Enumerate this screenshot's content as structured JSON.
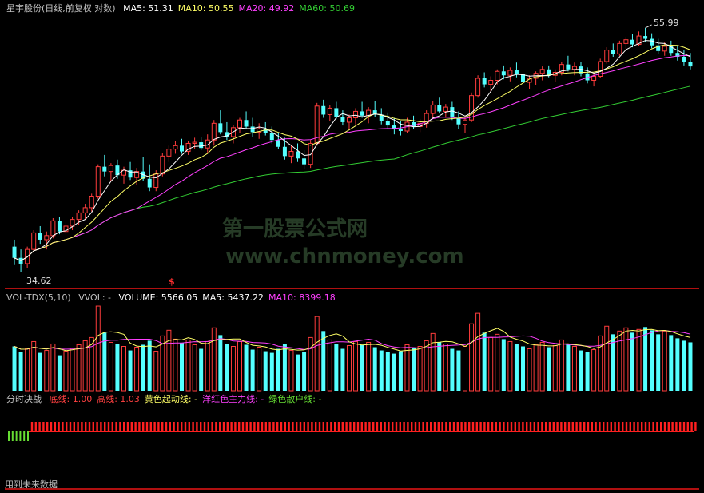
{
  "colors": {
    "bg": "#000000",
    "up": "#ff3c3c",
    "down": "#54ffff",
    "ma5": "#ffffff",
    "ma10": "#ffff66",
    "ma20": "#ff40ff",
    "ma60": "#33cc33",
    "frame": "#b01010",
    "green_bar": "#66dd33"
  },
  "price_panel": {
    "title": "星宇股份(日线,前复权 对数)",
    "ma_labels": [
      {
        "text": "MA5: 51.31",
        "color": "#ffffff"
      },
      {
        "text": "MA10: 50.55",
        "color": "#ffff66"
      },
      {
        "text": "MA20: 49.92",
        "color": "#ff40ff"
      },
      {
        "text": "MA60: 50.69",
        "color": "#33cc33"
      }
    ],
    "high_label": "55.99",
    "low_label": "34.62",
    "marker_label": "$"
  },
  "volume_panel": {
    "title": "VOL-TDX(5,10)",
    "vvol": "VVOL: -",
    "labels": [
      {
        "text": "VOLUME: 5566.05",
        "color": "#ffffff"
      },
      {
        "text": "MA5: 5437.22",
        "color": "#ffffff"
      },
      {
        "text": "MA10: 8399.18",
        "color": "#ff40ff"
      }
    ]
  },
  "indicator_panel": {
    "title": "分时决战",
    "labels": [
      {
        "text": "底线: 1.00",
        "color": "#ff4040"
      },
      {
        "text": "高线: 1.03",
        "color": "#ff4040"
      },
      {
        "text": "黄色起动线: -",
        "color": "#ffff66"
      },
      {
        "text": "洋红色主力线: -",
        "color": "#ff40ff"
      },
      {
        "text": "绿色散户线: -",
        "color": "#66dd33"
      }
    ],
    "footer": "用到未来数据"
  },
  "watermark": {
    "line1": "第一股票公式网",
    "line2": "www.chnmoney.com"
  },
  "chart_data": {
    "type": "candlestick",
    "scale": "log",
    "ylim": [
      34.62,
      55.99
    ],
    "candles": [
      [
        36.4,
        36.9,
        35.1,
        35.6
      ],
      [
        35.6,
        36.2,
        34.62,
        35.2
      ],
      [
        35.2,
        36.4,
        34.9,
        36.2
      ],
      [
        36.2,
        37.6,
        36.0,
        37.4
      ],
      [
        37.4,
        37.9,
        36.6,
        36.9
      ],
      [
        36.9,
        37.5,
        36.2,
        37.2
      ],
      [
        37.2,
        38.5,
        37.0,
        38.3
      ],
      [
        38.3,
        38.6,
        37.3,
        37.5
      ],
      [
        37.5,
        38.2,
        37.2,
        37.9
      ],
      [
        37.9,
        38.6,
        37.6,
        38.4
      ],
      [
        38.4,
        39.1,
        38.0,
        38.9
      ],
      [
        38.9,
        39.6,
        38.4,
        39.3
      ],
      [
        39.3,
        40.4,
        39.0,
        40.2
      ],
      [
        40.2,
        42.8,
        40.0,
        42.6
      ],
      [
        42.6,
        43.6,
        41.8,
        42.2
      ],
      [
        42.2,
        42.9,
        41.4,
        42.7
      ],
      [
        42.7,
        43.2,
        41.6,
        41.9
      ],
      [
        41.9,
        42.6,
        41.2,
        42.3
      ],
      [
        42.3,
        43.0,
        41.5,
        41.7
      ],
      [
        41.7,
        42.5,
        41.1,
        42.2
      ],
      [
        42.2,
        43.4,
        41.4,
        41.6
      ],
      [
        41.6,
        42.8,
        40.6,
        40.9
      ],
      [
        40.9,
        42.3,
        40.6,
        42.0
      ],
      [
        42.0,
        43.8,
        41.8,
        43.5
      ],
      [
        43.5,
        44.4,
        43.0,
        44.1
      ],
      [
        44.1,
        44.8,
        43.7,
        44.4
      ],
      [
        44.4,
        45.0,
        43.7,
        43.9
      ],
      [
        43.9,
        44.8,
        43.6,
        44.6
      ],
      [
        44.6,
        45.1,
        44.1,
        44.7
      ],
      [
        44.7,
        45.2,
        44.0,
        44.2
      ],
      [
        44.2,
        45.4,
        43.8,
        44.9
      ],
      [
        44.9,
        46.7,
        44.4,
        46.4
      ],
      [
        46.4,
        47.6,
        45.4,
        45.6
      ],
      [
        45.6,
        46.5,
        44.9,
        45.2
      ],
      [
        45.2,
        46.2,
        44.6,
        46.0
      ],
      [
        46.0,
        46.9,
        45.5,
        46.7
      ],
      [
        46.7,
        47.5,
        45.9,
        46.1
      ],
      [
        46.1,
        46.9,
        45.2,
        45.6
      ],
      [
        45.6,
        46.4,
        45.0,
        45.9
      ],
      [
        45.9,
        46.5,
        45.3,
        45.5
      ],
      [
        45.5,
        46.1,
        44.6,
        44.9
      ],
      [
        44.9,
        45.6,
        44.1,
        44.3
      ],
      [
        44.3,
        45.1,
        43.2,
        43.5
      ],
      [
        43.5,
        44.4,
        42.9,
        43.9
      ],
      [
        43.9,
        44.6,
        43.0,
        43.3
      ],
      [
        43.3,
        44.0,
        42.4,
        42.8
      ],
      [
        42.8,
        44.9,
        42.5,
        44.6
      ],
      [
        44.6,
        48.3,
        44.4,
        48.0
      ],
      [
        48.0,
        48.6,
        46.9,
        47.2
      ],
      [
        47.2,
        48.1,
        46.6,
        47.8
      ],
      [
        47.8,
        48.4,
        46.8,
        47.0
      ],
      [
        47.0,
        47.6,
        46.2,
        46.5
      ],
      [
        46.5,
        47.2,
        45.8,
        46.9
      ],
      [
        46.9,
        47.8,
        46.3,
        47.5
      ],
      [
        47.5,
        48.4,
        46.9,
        47.1
      ],
      [
        47.1,
        47.9,
        46.4,
        47.6
      ],
      [
        47.6,
        48.5,
        47.0,
        47.2
      ],
      [
        47.2,
        47.8,
        46.3,
        46.6
      ],
      [
        46.6,
        47.4,
        45.9,
        46.2
      ],
      [
        46.2,
        46.9,
        45.4,
        45.9
      ],
      [
        45.9,
        46.6,
        45.3,
        45.7
      ],
      [
        45.7,
        46.9,
        45.5,
        46.5
      ],
      [
        46.5,
        47.1,
        45.9,
        46.1
      ],
      [
        46.1,
        46.8,
        45.6,
        46.4
      ],
      [
        46.4,
        47.6,
        46.0,
        47.3
      ],
      [
        47.3,
        48.5,
        46.8,
        48.1
      ],
      [
        48.1,
        48.8,
        47.3,
        47.5
      ],
      [
        47.5,
        48.2,
        46.9,
        47.9
      ],
      [
        47.9,
        48.4,
        46.7,
        46.9
      ],
      [
        46.9,
        47.5,
        45.9,
        46.3
      ],
      [
        46.3,
        47.0,
        45.5,
        46.7
      ],
      [
        46.7,
        49.3,
        46.5,
        49.0
      ],
      [
        49.0,
        51.0,
        48.8,
        50.7
      ],
      [
        50.7,
        51.3,
        49.8,
        50.1
      ],
      [
        50.1,
        50.9,
        49.4,
        50.5
      ],
      [
        50.5,
        51.6,
        50.1,
        51.4
      ],
      [
        51.4,
        52.0,
        50.6,
        51.0
      ],
      [
        51.0,
        51.8,
        50.4,
        51.5
      ],
      [
        51.5,
        52.3,
        50.8,
        51.1
      ],
      [
        51.1,
        51.7,
        50.1,
        50.3
      ],
      [
        50.3,
        51.0,
        49.6,
        50.7
      ],
      [
        50.7,
        51.4,
        50.0,
        51.2
      ],
      [
        51.2,
        51.9,
        50.5,
        51.6
      ],
      [
        51.6,
        52.0,
        50.8,
        51.0
      ],
      [
        51.0,
        51.6,
        50.3,
        51.3
      ],
      [
        51.3,
        52.4,
        51.0,
        52.1
      ],
      [
        52.1,
        53.0,
        51.4,
        51.6
      ],
      [
        51.6,
        52.3,
        51.0,
        51.9
      ],
      [
        51.9,
        52.4,
        50.9,
        51.2
      ],
      [
        51.2,
        51.8,
        50.2,
        50.5
      ],
      [
        50.5,
        51.2,
        49.9,
        50.9
      ],
      [
        50.9,
        52.7,
        50.7,
        52.4
      ],
      [
        52.4,
        53.9,
        52.2,
        53.6
      ],
      [
        53.6,
        54.3,
        52.9,
        53.2
      ],
      [
        53.2,
        54.6,
        53.0,
        54.3
      ],
      [
        54.3,
        55.0,
        53.6,
        54.7
      ],
      [
        54.7,
        55.3,
        53.9,
        54.2
      ],
      [
        54.2,
        55.6,
        54.0,
        55.1
      ],
      [
        55.1,
        55.99,
        54.5,
        54.8
      ],
      [
        54.8,
        55.4,
        53.8,
        54.1
      ],
      [
        54.1,
        54.8,
        53.2,
        53.5
      ],
      [
        53.5,
        54.4,
        53.0,
        54.0
      ],
      [
        54.0,
        54.6,
        53.0,
        53.3
      ],
      [
        53.3,
        54.0,
        52.5,
        52.9
      ],
      [
        52.9,
        53.6,
        52.0,
        52.4
      ],
      [
        52.4,
        53.3,
        51.6,
        51.9
      ]
    ],
    "volume": [
      55,
      48,
      52,
      61,
      47,
      50,
      58,
      44,
      49,
      53,
      57,
      62,
      66,
      105,
      72,
      60,
      58,
      55,
      50,
      54,
      57,
      62,
      49,
      68,
      75,
      64,
      59,
      63,
      57,
      52,
      61,
      78,
      69,
      58,
      55,
      61,
      57,
      51,
      54,
      49,
      47,
      52,
      58,
      50,
      45,
      48,
      66,
      92,
      74,
      63,
      58,
      52,
      56,
      61,
      57,
      60,
      54,
      50,
      48,
      46,
      49,
      57,
      53,
      55,
      62,
      71,
      60,
      58,
      52,
      50,
      55,
      83,
      96,
      72,
      66,
      70,
      64,
      61,
      58,
      55,
      52,
      57,
      60,
      54,
      56,
      63,
      58,
      55,
      50,
      48,
      51,
      68,
      80,
      70,
      74,
      78,
      72,
      76,
      79,
      75,
      70,
      74,
      69,
      65,
      62,
      60
    ]
  }
}
